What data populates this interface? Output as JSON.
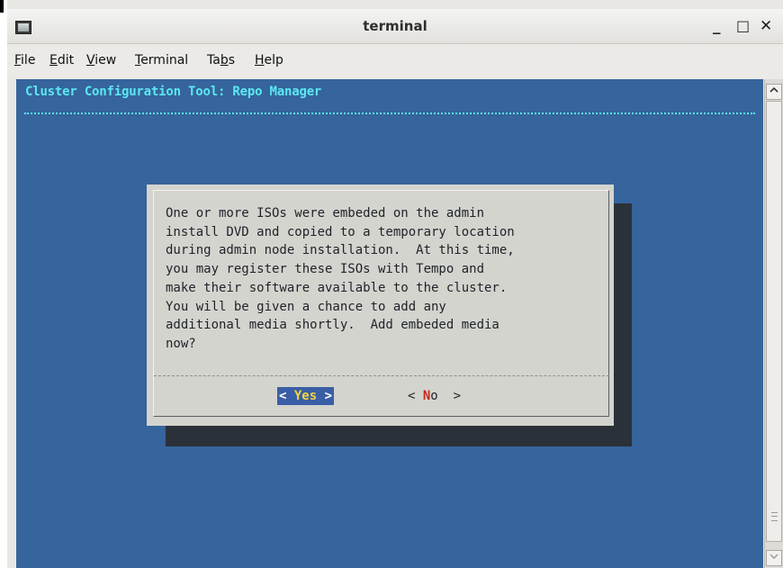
{
  "window": {
    "title": "terminal",
    "controls": {
      "minimize": "_",
      "maximize": "□",
      "close": "✕"
    }
  },
  "menubar": {
    "items": [
      {
        "prefix": "",
        "mnemonic": "F",
        "suffix": "ile"
      },
      {
        "prefix": "",
        "mnemonic": "E",
        "suffix": "dit"
      },
      {
        "prefix": "",
        "mnemonic": "V",
        "suffix": "iew"
      },
      {
        "prefix": "",
        "mnemonic": "T",
        "suffix": "erminal"
      },
      {
        "prefix": "Ta",
        "mnemonic": "b",
        "suffix": "s"
      },
      {
        "prefix": "",
        "mnemonic": "H",
        "suffix": "elp"
      }
    ]
  },
  "terminal": {
    "heading": "Cluster Configuration Tool: Repo Manager",
    "background": "#36649c",
    "heading_color": "#5be8f0"
  },
  "dialog": {
    "message": "One or more ISOs were embeded on the admin\ninstall DVD and copied to a temporary location\nduring admin node installation.  At this time,\nyou may register these ISOs with Tempo and\nmake their software available to the cluster.\nYou will be given a chance to add any\nadditional media shortly.  Add embeded media\nnow?",
    "yes_button": {
      "open": "< ",
      "hotkey": "Y",
      "rest": "es",
      "close": " >"
    },
    "no_button": {
      "open": "< ",
      "hotkey": "N",
      "rest": "o",
      "close": "  >"
    },
    "selected": "Yes"
  },
  "scrollbar": {
    "up_icon": "scroll-up-arrow-icon",
    "down_icon": "scroll-down-arrow-icon"
  }
}
